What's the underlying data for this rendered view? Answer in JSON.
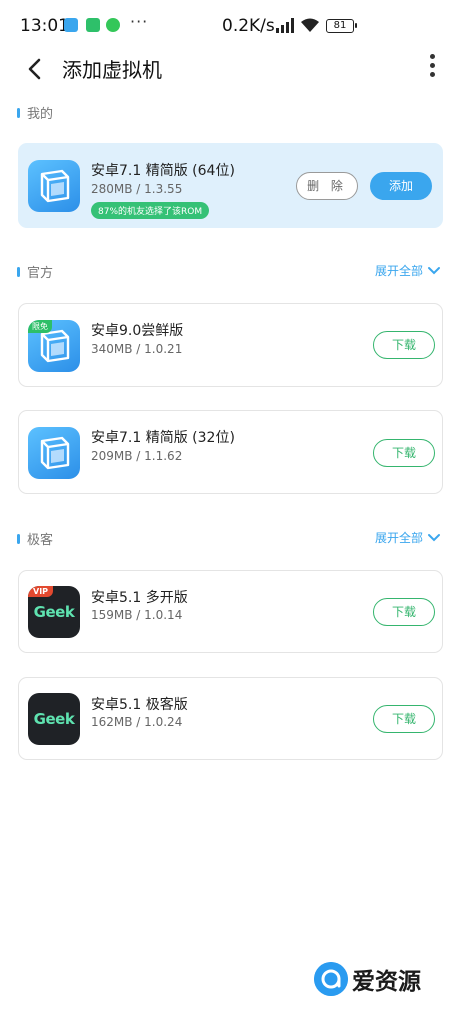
{
  "status": {
    "time": "13:01",
    "dots": "···",
    "speed": "0.2K/s",
    "battery": "81"
  },
  "header": {
    "title": "添加虚拟机"
  },
  "sections": {
    "mine": "我的",
    "official": "官方",
    "geek": "极客"
  },
  "expand_label": "展开全部",
  "mine_card": {
    "name": "安卓7.1 精简版 (64位)",
    "meta": "280MB / 1.3.55",
    "tag": "87%的机友选择了该ROM",
    "delete_label": "删 除",
    "add_label": "添加"
  },
  "official_cards": [
    {
      "name": "安卓9.0尝鲜版",
      "meta": "340MB / 1.0.21",
      "badge": "限免",
      "button": "下载"
    },
    {
      "name": "安卓7.1 精简版 (32位)",
      "meta": "209MB / 1.1.62",
      "button": "下载"
    }
  ],
  "geek_cards": [
    {
      "name": "安卓5.1 多开版",
      "meta": "159MB / 1.0.14",
      "badge": "VIP",
      "logo": "Geek",
      "button": "下载"
    },
    {
      "name": "安卓5.1 极客版",
      "meta": "162MB / 1.0.24",
      "logo": "Geek",
      "button": "下载"
    }
  ],
  "watermark": "爱资源",
  "colors": {
    "accent": "#3aa6ee",
    "download": "#35b56e",
    "mine_bg": "#dff0fc"
  }
}
